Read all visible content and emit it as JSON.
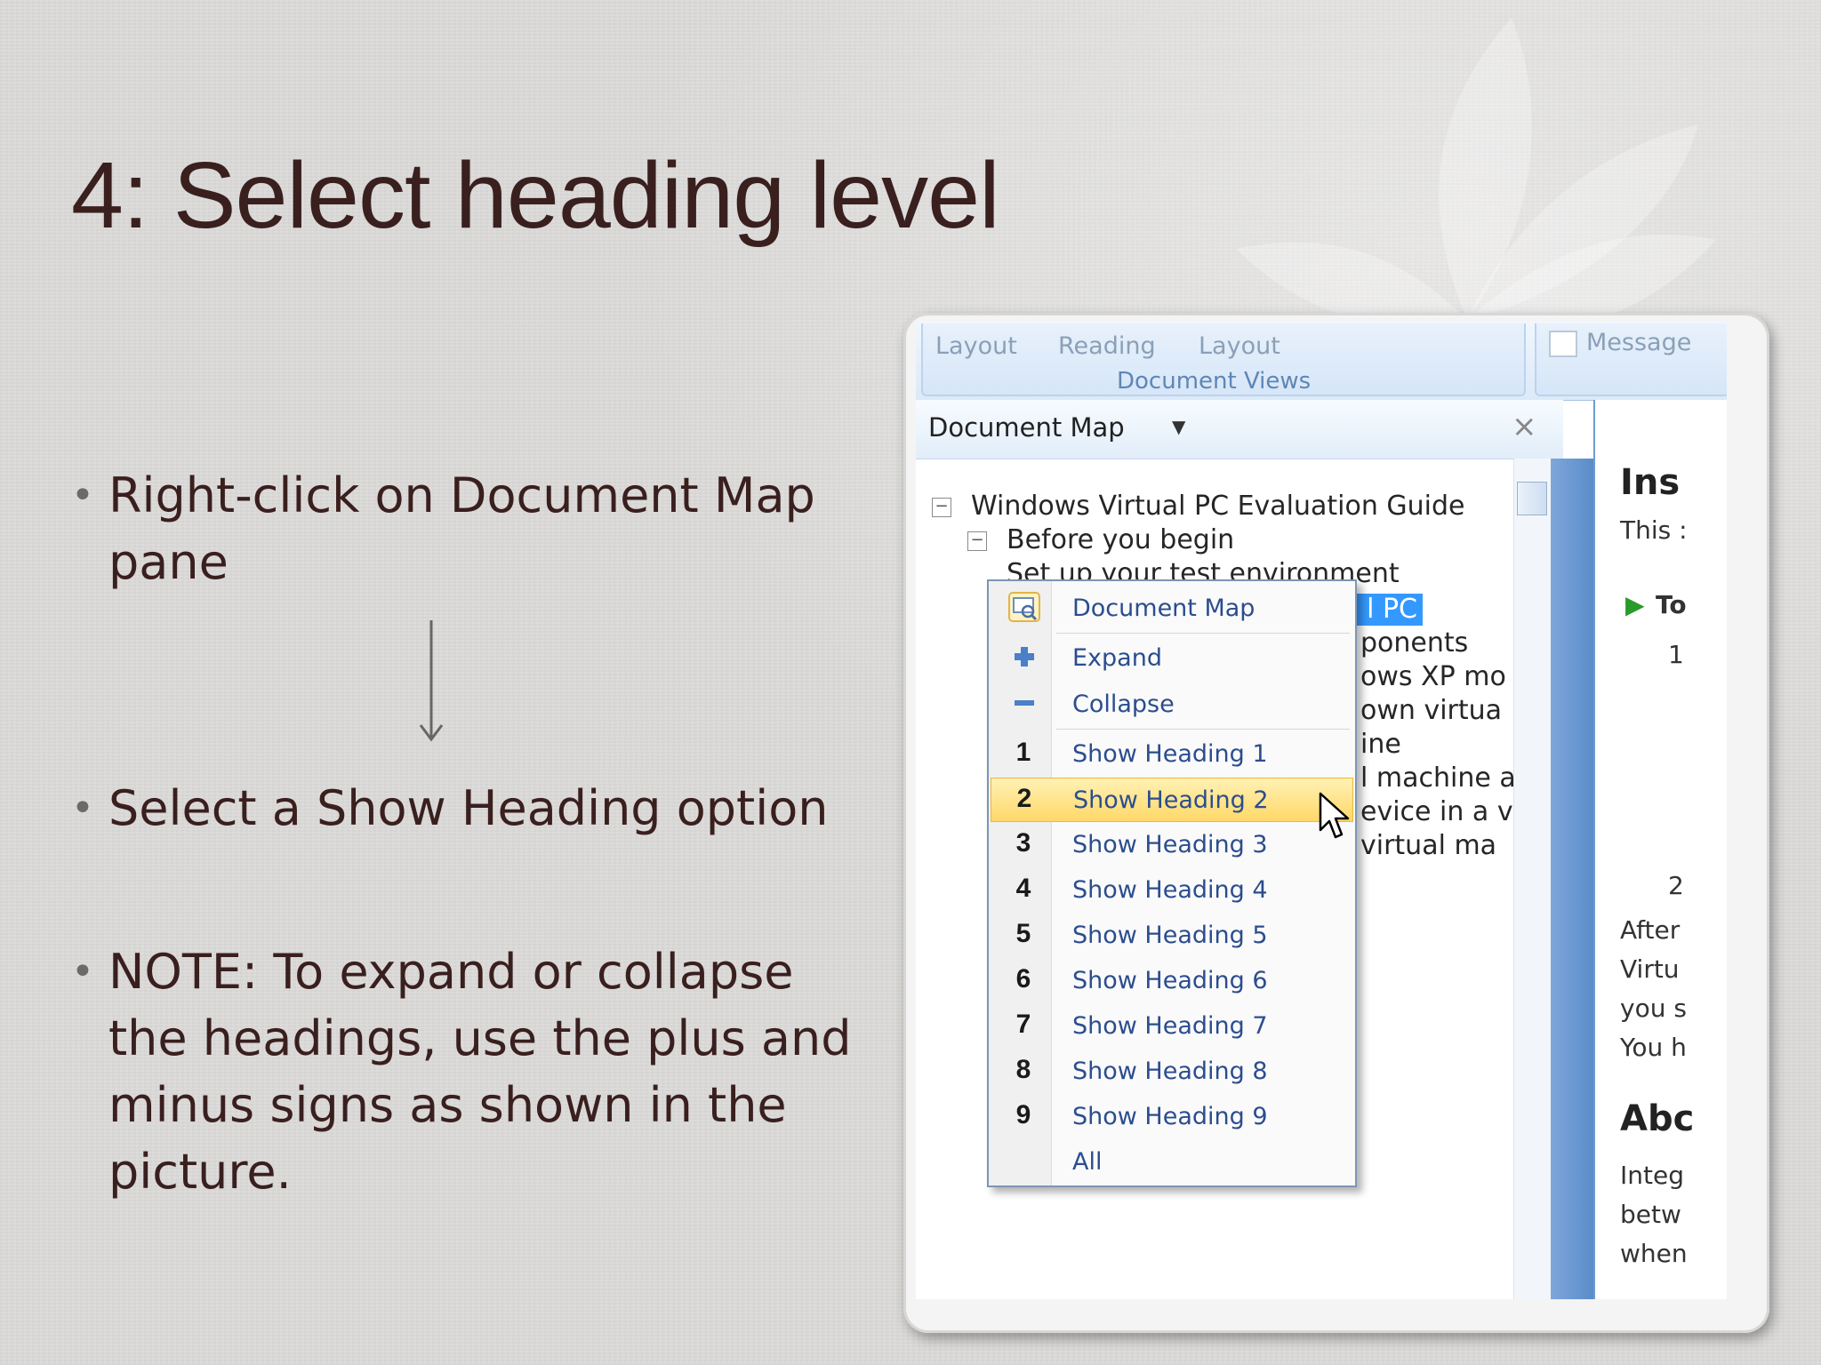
{
  "slide": {
    "title": "4: Select heading level",
    "bullets": [
      "Right-click on Document Map pane",
      "Select a Show Heading option",
      "NOTE: To expand or collapse the headings, use the plus and minus signs as shown in the picture."
    ]
  },
  "screenshot": {
    "ribbon": {
      "buttons": [
        "Layout",
        "Reading",
        "Layout"
      ],
      "group_label": "Document Views",
      "message_label": "Message"
    },
    "document_map": {
      "title": "Document Map",
      "dropdown_icon": "chevron-down-icon",
      "close_icon": "close-icon",
      "tree": [
        "Windows Virtual PC Evaluation Guide",
        "Before you begin",
        "Set up your test environment"
      ],
      "selected_item_visible": "l PC",
      "partial_items": [
        "ponents",
        "ows XP mo",
        "own virtua",
        "ine",
        "l machine a",
        "evice in a v",
        "virtual ma"
      ]
    },
    "doc_pane": {
      "heading1": "Ins",
      "line1": "This :",
      "line2": "To",
      "n1": "1",
      "n2": "2",
      "para": [
        "After",
        "Virtu",
        "you s",
        "You h"
      ],
      "heading2": "Abc",
      "para2": [
        "Integ",
        "betw",
        "when"
      ]
    },
    "context_menu": {
      "items": [
        {
          "icon": "document-map-icon",
          "num": "",
          "label": "Document Map"
        },
        {
          "icon": "plus-icon",
          "num": "",
          "label": "Expand"
        },
        {
          "icon": "minus-icon",
          "num": "",
          "label": "Collapse"
        },
        {
          "icon": "",
          "num": "1",
          "label": "Show Heading 1"
        },
        {
          "icon": "",
          "num": "2",
          "label": "Show Heading 2"
        },
        {
          "icon": "",
          "num": "3",
          "label": "Show Heading 3"
        },
        {
          "icon": "",
          "num": "4",
          "label": "Show Heading 4"
        },
        {
          "icon": "",
          "num": "5",
          "label": "Show Heading 5"
        },
        {
          "icon": "",
          "num": "6",
          "label": "Show Heading 6"
        },
        {
          "icon": "",
          "num": "7",
          "label": "Show Heading 7"
        },
        {
          "icon": "",
          "num": "8",
          "label": "Show Heading 8"
        },
        {
          "icon": "",
          "num": "9",
          "label": "Show Heading 9"
        },
        {
          "icon": "",
          "num": "",
          "label": "All"
        }
      ],
      "highlighted_label": "Show Heading 2"
    },
    "colors": {
      "accent_blue": "#3399ff",
      "menu_highlight": "#ffd868",
      "link_text": "#2b4d8f",
      "title_text": "#3a1f1f"
    }
  }
}
